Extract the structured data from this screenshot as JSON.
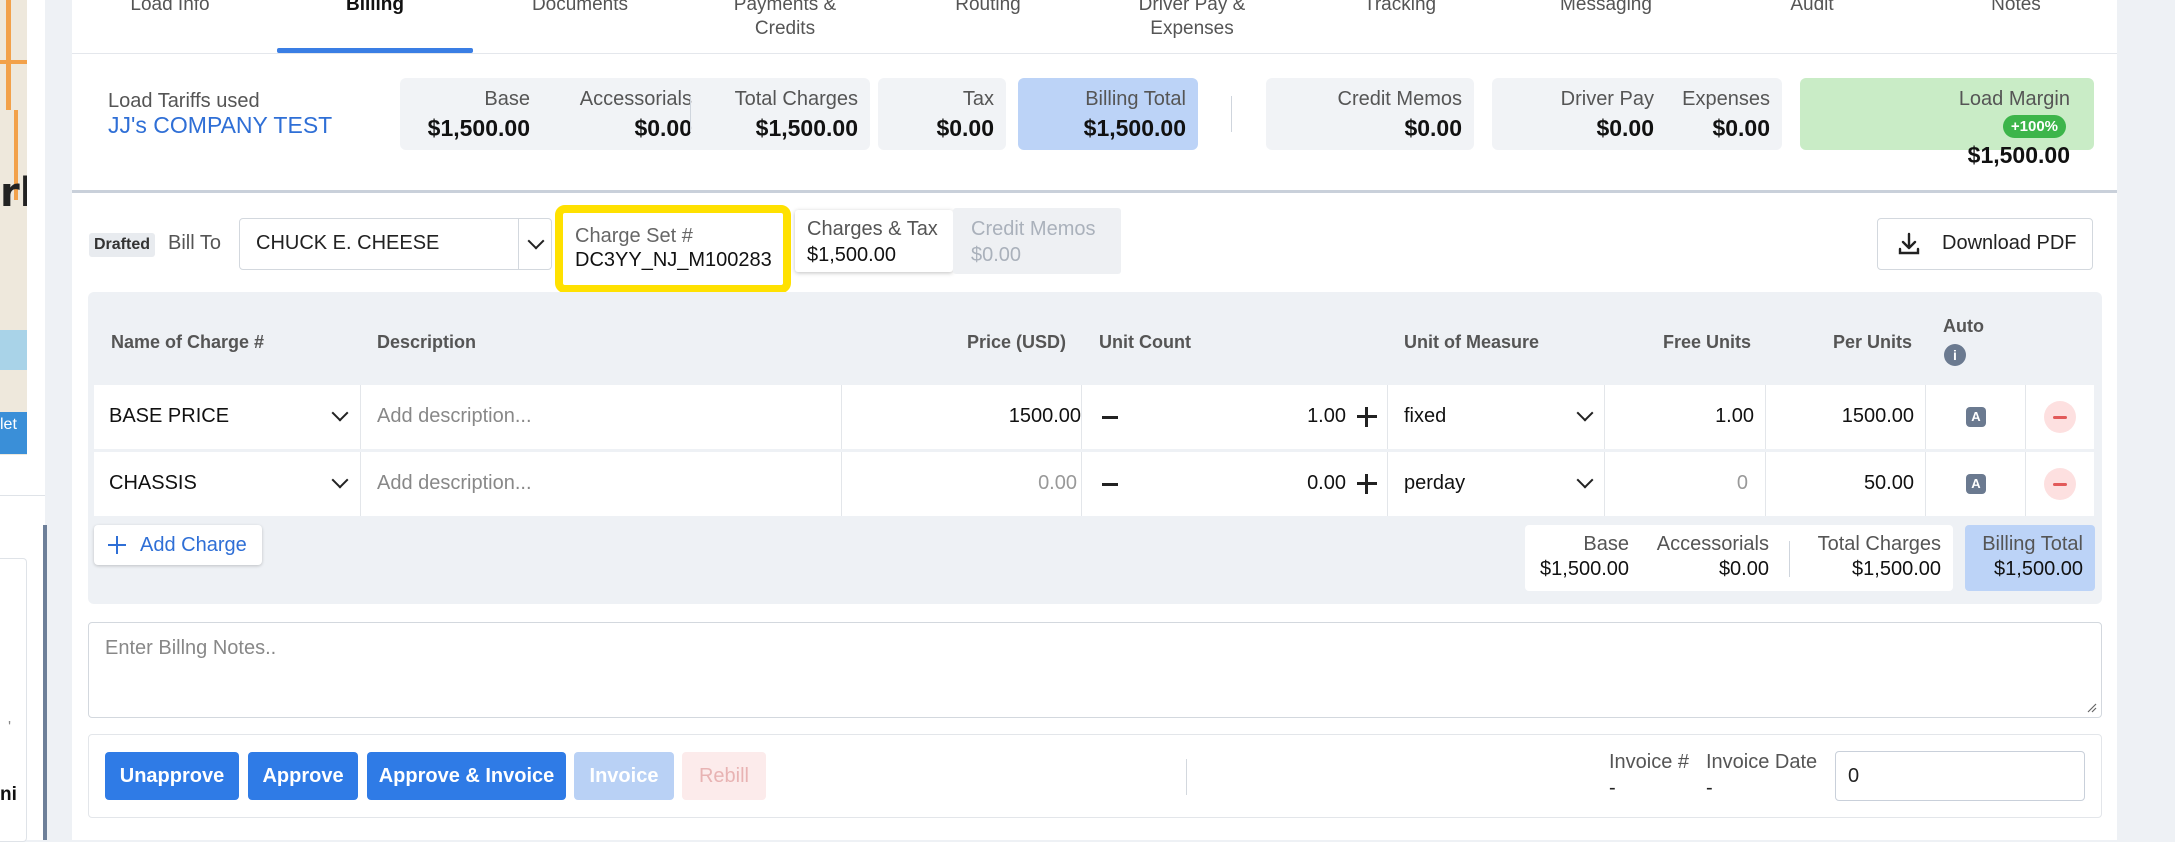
{
  "tabs": [
    {
      "label": "Load Info"
    },
    {
      "label": "Billing"
    },
    {
      "label": "Documents"
    },
    {
      "label": "Payments &\nCredits"
    },
    {
      "label": "Routing"
    },
    {
      "label": "Driver Pay &\nExpenses"
    },
    {
      "label": "Tracking"
    },
    {
      "label": "Messaging"
    },
    {
      "label": "Audit"
    },
    {
      "label": "Notes"
    }
  ],
  "active_tab": "Billing",
  "left_panel": {
    "map_text_fragment": "rk",
    "map_attribution_fragment": "let",
    "fragment_text": "ni"
  },
  "summary": {
    "tariffs_label": "Load Tariffs used",
    "tariff_name": "JJ's COMPANY TEST",
    "base_label": "Base",
    "base_value": "$1,500.00",
    "accessorials_label": "Accessorials",
    "accessorials_value": "$0.00",
    "total_charges_label": "Total Charges",
    "total_charges_value": "$1,500.00",
    "tax_label": "Tax",
    "tax_value": "$0.00",
    "billing_total_label": "Billing Total",
    "billing_total_value": "$1,500.00",
    "credit_memos_label": "Credit Memos",
    "credit_memos_value": "$0.00",
    "driver_pay_label": "Driver Pay",
    "driver_pay_value": "$0.00",
    "expenses_label": "Expenses",
    "expenses_value": "$0.00",
    "load_margin_label": "Load Margin",
    "load_margin_badge": "+100%",
    "load_margin_value": "$1,500.00"
  },
  "billing": {
    "status_badge": "Drafted",
    "bill_to_label": "Bill To",
    "bill_to_value": "CHUCK E. CHEESE",
    "charge_set_label": "Charge Set #",
    "charge_set_value": "DC3YY_NJ_M100283",
    "charges_tax_label": "Charges & Tax",
    "charges_tax_value": "$1,500.00",
    "credit_memos_label": "Credit Memos",
    "credit_memos_value": "$0.00",
    "download_label": "Download PDF"
  },
  "table": {
    "headers": {
      "name": "Name of Charge #",
      "description": "Description",
      "price": "Price (USD)",
      "unit_count": "Unit Count",
      "unit_measure": "Unit of Measure",
      "free_units": "Free Units",
      "per_units": "Per Units",
      "auto": "Auto"
    },
    "rows": [
      {
        "name": "BASE PRICE",
        "description_placeholder": "Add description...",
        "price": "1500.00",
        "unit_count": "1.00",
        "unit_measure": "fixed",
        "free_units": "1.00",
        "per_units": "1500.00",
        "auto": "A"
      },
      {
        "name": "CHASSIS",
        "description_placeholder": "Add description...",
        "price": "0.00",
        "unit_count": "0.00",
        "unit_measure": "perday",
        "free_units": "0",
        "per_units": "50.00",
        "auto": "A"
      }
    ],
    "add_charge_label": "Add Charge",
    "totals": {
      "base_label": "Base",
      "base_value": "$1,500.00",
      "accessorials_label": "Accessorials",
      "accessorials_value": "$0.00",
      "total_charges_label": "Total Charges",
      "total_charges_value": "$1,500.00",
      "billing_total_label": "Billing Total",
      "billing_total_value": "$1,500.00"
    }
  },
  "notes_placeholder": "Enter Billng Notes..",
  "actions": {
    "unapprove": "Unapprove",
    "approve": "Approve",
    "approve_invoice": "Approve & Invoice",
    "invoice": "Invoice",
    "rebill": "Rebill",
    "invoice_num_label": "Invoice #",
    "invoice_num_value": "-",
    "invoice_date_label": "Invoice Date",
    "invoice_date_value": "-",
    "invoice_date_input": "0"
  },
  "colors": {
    "accent": "#2f7be6",
    "billing_total_bg": "#bcd3f7",
    "margin_bg": "#c9ecc6",
    "margin_badge": "#3cb54a",
    "highlight": "#ffe100",
    "remove": "#e25a5a"
  }
}
